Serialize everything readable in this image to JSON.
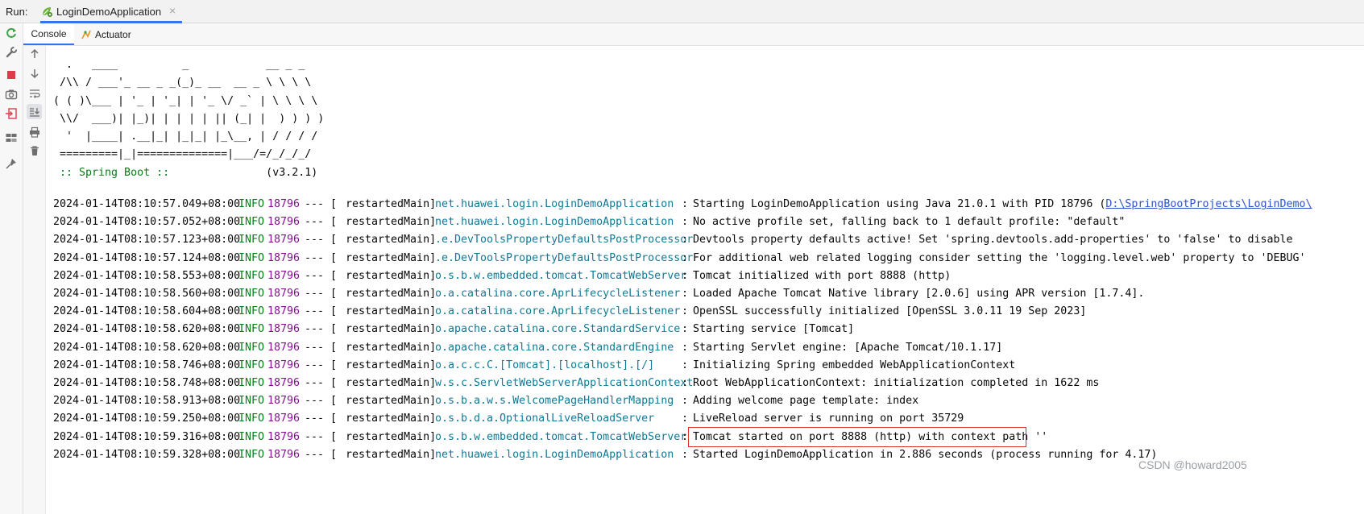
{
  "run_bar": {
    "label": "Run:",
    "tab_title": "LoginDemoApplication",
    "tab_close": "×"
  },
  "left_toolbar": {
    "icons": [
      "rerun-icon",
      "wrench-icon",
      "stop-icon",
      "camera-icon",
      "exit-icon",
      "layout-icon",
      "pin-icon"
    ]
  },
  "tabs": [
    {
      "label": "Console",
      "active": true
    },
    {
      "label": "Actuator",
      "active": false
    }
  ],
  "console_toolbar": {
    "icons": [
      "up-arrow-icon",
      "down-arrow-icon",
      "soft-wrap-icon",
      "scroll-to-end-icon",
      "print-icon",
      "clear-trash-icon"
    ]
  },
  "banner": {
    "lines": [
      "  .   ____          _            __ _ _",
      " /\\\\ / ___'_ __ _ _(_)_ __  __ _ \\ \\ \\ \\",
      "( ( )\\___ | '_ | '_| | '_ \\/ _` | \\ \\ \\ \\",
      " \\\\/  ___)| |_)| | | | | || (_| |  ) ) ) )",
      "  '  |____| .__|_| |_|_| |_\\__, | / / / /",
      " =========|_|==============|___/=/_/_/_/"
    ],
    "spring_label": " :: Spring Boot :: ",
    "version": "              (v3.2.1)"
  },
  "log_lines": [
    {
      "ts": "2024-01-14T08:10:57.049+08:00",
      "level": "INFO",
      "pid": "18796",
      "sep": "--- [",
      "thread": "restartedMain]",
      "logger": "net.huawei.login.LoginDemoApplication",
      "colon": ":",
      "msg": "Starting LoginDemoApplication using Java 21.0.1 with PID 18796 (",
      "link": "D:\\SpringBootProjects\\LoginDemo\\"
    },
    {
      "ts": "2024-01-14T08:10:57.052+08:00",
      "level": "INFO",
      "pid": "18796",
      "sep": "--- [",
      "thread": "restartedMain]",
      "logger": "net.huawei.login.LoginDemoApplication",
      "colon": ":",
      "msg": "No active profile set, falling back to 1 default profile: \"default\""
    },
    {
      "ts": "2024-01-14T08:10:57.123+08:00",
      "level": "INFO",
      "pid": "18796",
      "sep": "--- [",
      "thread": "restartedMain]",
      "logger": ".e.DevToolsPropertyDefaultsPostProcessor",
      "colon": ":",
      "msg": "Devtools property defaults active! Set 'spring.devtools.add-properties' to 'false' to disable"
    },
    {
      "ts": "2024-01-14T08:10:57.124+08:00",
      "level": "INFO",
      "pid": "18796",
      "sep": "--- [",
      "thread": "restartedMain]",
      "logger": ".e.DevToolsPropertyDefaultsPostProcessor",
      "colon": ":",
      "msg": "For additional web related logging consider setting the 'logging.level.web' property to 'DEBUG'"
    },
    {
      "ts": "2024-01-14T08:10:58.553+08:00",
      "level": "INFO",
      "pid": "18796",
      "sep": "--- [",
      "thread": "restartedMain]",
      "logger": "o.s.b.w.embedded.tomcat.TomcatWebServer",
      "colon": ":",
      "msg": "Tomcat initialized with port 8888 (http)"
    },
    {
      "ts": "2024-01-14T08:10:58.560+08:00",
      "level": "INFO",
      "pid": "18796",
      "sep": "--- [",
      "thread": "restartedMain]",
      "logger": "o.a.catalina.core.AprLifecycleListener",
      "colon": ":",
      "msg": "Loaded Apache Tomcat Native library [2.0.6] using APR version [1.7.4]."
    },
    {
      "ts": "2024-01-14T08:10:58.604+08:00",
      "level": "INFO",
      "pid": "18796",
      "sep": "--- [",
      "thread": "restartedMain]",
      "logger": "o.a.catalina.core.AprLifecycleListener",
      "colon": ":",
      "msg": "OpenSSL successfully initialized [OpenSSL 3.0.11 19 Sep 2023]"
    },
    {
      "ts": "2024-01-14T08:10:58.620+08:00",
      "level": "INFO",
      "pid": "18796",
      "sep": "--- [",
      "thread": "restartedMain]",
      "logger": "o.apache.catalina.core.StandardService",
      "colon": ":",
      "msg": "Starting service [Tomcat]"
    },
    {
      "ts": "2024-01-14T08:10:58.620+08:00",
      "level": "INFO",
      "pid": "18796",
      "sep": "--- [",
      "thread": "restartedMain]",
      "logger": "o.apache.catalina.core.StandardEngine",
      "colon": ":",
      "msg": "Starting Servlet engine: [Apache Tomcat/10.1.17]"
    },
    {
      "ts": "2024-01-14T08:10:58.746+08:00",
      "level": "INFO",
      "pid": "18796",
      "sep": "--- [",
      "thread": "restartedMain]",
      "logger": "o.a.c.c.C.[Tomcat].[localhost].[/]",
      "colon": ":",
      "msg": "Initializing Spring embedded WebApplicationContext"
    },
    {
      "ts": "2024-01-14T08:10:58.748+08:00",
      "level": "INFO",
      "pid": "18796",
      "sep": "--- [",
      "thread": "restartedMain]",
      "logger": "w.s.c.ServletWebServerApplicationContext",
      "colon": ":",
      "msg": "Root WebApplicationContext: initialization completed in 1622 ms"
    },
    {
      "ts": "2024-01-14T08:10:58.913+08:00",
      "level": "INFO",
      "pid": "18796",
      "sep": "--- [",
      "thread": "restartedMain]",
      "logger": "o.s.b.a.w.s.WelcomePageHandlerMapping",
      "colon": ":",
      "msg": "Adding welcome page template: index"
    },
    {
      "ts": "2024-01-14T08:10:59.250+08:00",
      "level": "INFO",
      "pid": "18796",
      "sep": "--- [",
      "thread": "restartedMain]",
      "logger": "o.s.b.d.a.OptionalLiveReloadServer",
      "colon": ":",
      "msg": "LiveReload server is running on port 35729"
    },
    {
      "ts": "2024-01-14T08:10:59.316+08:00",
      "level": "INFO",
      "pid": "18796",
      "sep": "--- [",
      "thread": "restartedMain]",
      "logger": "o.s.b.w.embedded.tomcat.TomcatWebServer",
      "colon": ":",
      "msg": "Tomcat started on port 8888 (http) with context path ''"
    },
    {
      "ts": "2024-01-14T08:10:59.328+08:00",
      "level": "INFO",
      "pid": "18796",
      "sep": "--- [",
      "thread": "restartedMain]",
      "logger": "net.huawei.login.LoginDemoApplication",
      "colon": ":",
      "msg": "Started LoginDemoApplication in 2.886 seconds (process running for 4.17)"
    }
  ],
  "watermark": "CSDN @howard2005",
  "colors": {
    "accent": "#3574f0",
    "info": "#067d17",
    "pid": "#871094",
    "logger": "#0f7a99",
    "link": "#2d53c7",
    "highlight": "#e0302b"
  }
}
